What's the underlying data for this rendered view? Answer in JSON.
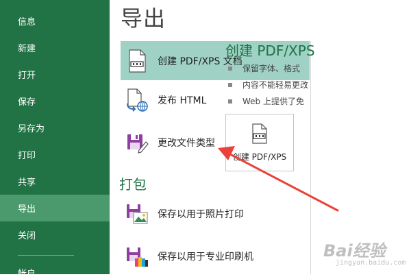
{
  "sidebar": {
    "items": [
      {
        "label": "信息"
      },
      {
        "label": "新建"
      },
      {
        "label": "打开"
      },
      {
        "label": "保存"
      },
      {
        "label": "另存为"
      },
      {
        "label": "打印"
      },
      {
        "label": "共享"
      },
      {
        "label": "导出",
        "active": true
      },
      {
        "label": "关闭"
      }
    ],
    "more_label": "帐户"
  },
  "main": {
    "title": "导出",
    "export_options": [
      {
        "label": "创建 PDF/XPS 文档",
        "icon": "pdf-document-icon",
        "selected": true
      },
      {
        "label": "发布 HTML",
        "icon": "publish-html-icon"
      },
      {
        "label": "更改文件类型",
        "icon": "floppy-disk-edit-icon"
      }
    ],
    "package_section_title": "打包",
    "package_options": [
      {
        "label": "保存以用于照片打印",
        "icon": "photo-print-icon"
      },
      {
        "label": "保存以用于专业印刷机",
        "icon": "pro-print-icon"
      }
    ]
  },
  "right_panel": {
    "title": "创建 PDF/XPS",
    "bullets": [
      "保留字体、格式",
      "内容不能轻易更改",
      "Web 上提供了免"
    ],
    "button_label": "创建 PDF/XPS"
  },
  "watermark": {
    "text": "Bai经验",
    "subtext": "jingyan.baidu.com"
  },
  "colors": {
    "sidebar_bg": "#217346",
    "sidebar_active": "#4b9a6d",
    "selected_option": "#9fd1c5",
    "accent": "#217346",
    "annotation_arrow": "#e8423a"
  }
}
